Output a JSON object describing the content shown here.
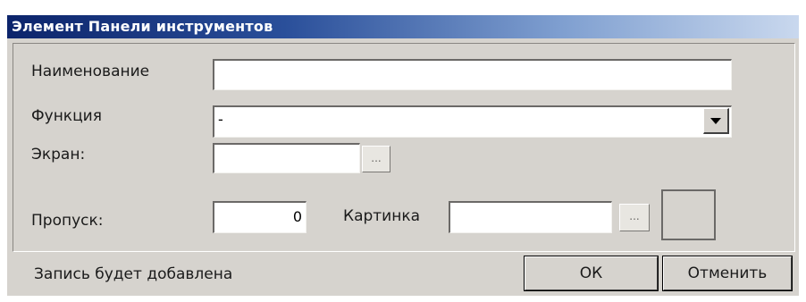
{
  "window": {
    "title": "Элемент Панели инструментов"
  },
  "form": {
    "name_label": "Наименование",
    "name_value": "",
    "function_label": "Функция",
    "function_value": "-",
    "screen_label": "Экран:",
    "screen_value": "",
    "screen_browse": "...",
    "skip_label": "Пропуск:",
    "skip_value": "0",
    "picture_label": "Картинка",
    "picture_value": "",
    "picture_browse": "..."
  },
  "footer": {
    "status_text": "Запись будет добавлена",
    "ok_label": "ОК",
    "cancel_label": "Отменить"
  }
}
